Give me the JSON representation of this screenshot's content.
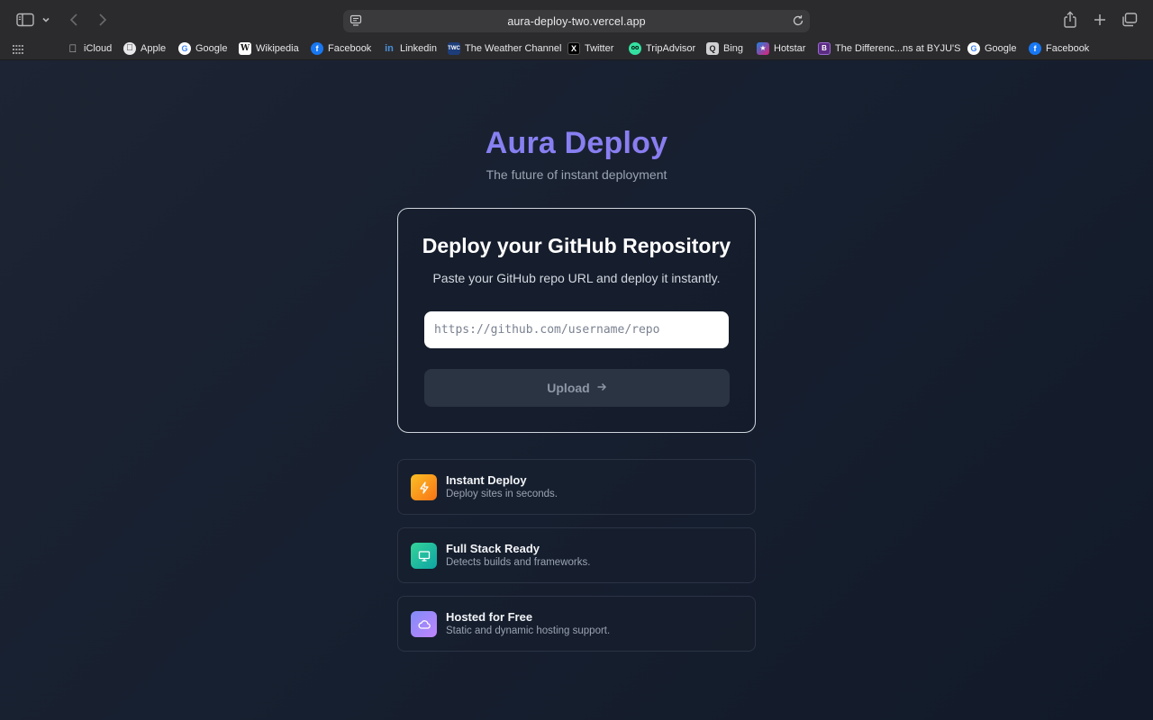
{
  "browser": {
    "url": "aura-deploy-two.vercel.app",
    "bookmarks": [
      {
        "label": "iCloud",
        "icon": "apple-icon"
      },
      {
        "label": "Apple",
        "icon": "apple-icon"
      },
      {
        "label": "Google",
        "icon": "google-icon"
      },
      {
        "label": "Wikipedia",
        "icon": "wikipedia-icon"
      },
      {
        "label": "Facebook",
        "icon": "facebook-icon"
      },
      {
        "label": "Linkedin",
        "icon": "linkedin-icon"
      },
      {
        "label": "The Weather Channel",
        "icon": "weather-channel-icon"
      },
      {
        "label": "Twitter",
        "icon": "x-icon"
      },
      {
        "label": "TripAdvisor",
        "icon": "tripadvisor-icon"
      },
      {
        "label": "Bing",
        "icon": "bing-icon"
      },
      {
        "label": "Hotstar",
        "icon": "hotstar-icon"
      },
      {
        "label": "The Differenc...ns at BYJU'S",
        "icon": "byjus-icon"
      },
      {
        "label": "Google",
        "icon": "google-icon"
      },
      {
        "label": "Facebook",
        "icon": "facebook-icon"
      }
    ]
  },
  "hero": {
    "title": "Aura Deploy",
    "tagline": "The future of instant deployment"
  },
  "deploy_card": {
    "title": "Deploy your GitHub Repository",
    "subtitle": "Paste your GitHub repo URL and deploy it instantly.",
    "input_placeholder": "https://github.com/username/repo",
    "input_value": "",
    "button_label": "Upload"
  },
  "features": [
    {
      "title": "Instant Deploy",
      "description": "Deploy sites in seconds.",
      "icon": "lightning-icon"
    },
    {
      "title": "Full Stack Ready",
      "description": "Detects builds and frameworks.",
      "icon": "monitor-icon"
    },
    {
      "title": "Hosted for Free",
      "description": "Static and dynamic hosting support.",
      "icon": "cloud-icon"
    }
  ],
  "colors": {
    "brand_gradient_start": "#7c8cf8",
    "brand_gradient_end": "#a47cf0",
    "instant_icon": "#f59e0b",
    "fullstack_icon": "#10b981",
    "hosted_icon": "#8b5cf6"
  }
}
